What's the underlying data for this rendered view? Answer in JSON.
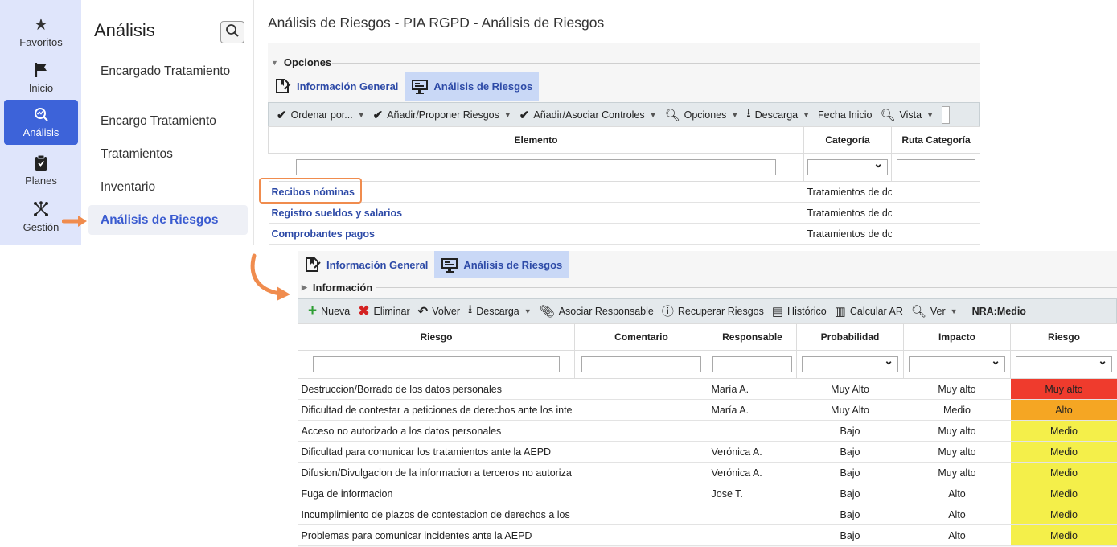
{
  "rail": [
    {
      "icon": "★",
      "label": "Favoritos",
      "active": false
    },
    {
      "icon": "⚑",
      "label": "Inicio",
      "active": false
    },
    {
      "icon": "⌕",
      "label": "Análisis",
      "active": true
    },
    {
      "icon": "▣",
      "label": "Planes",
      "active": false
    },
    {
      "icon": "✕",
      "label": "Gestión",
      "active": false
    }
  ],
  "menu": {
    "title": "Análisis",
    "items": [
      {
        "label": "Encargado Tratamiento"
      },
      {
        "label": "Encargo Tratamiento"
      },
      {
        "label": "Tratamientos"
      },
      {
        "label": "Inventario"
      },
      {
        "label": "Análisis de Riesgos"
      }
    ]
  },
  "page_title": "Análisis de Riesgos - PIA RGPD - Análisis de Riesgos",
  "top": {
    "section": "Opciones",
    "tabs": [
      "Información General",
      "Análisis de Riesgos"
    ],
    "toolbar": {
      "sort": "Ordenar por...",
      "add_risks": "Añadir/Proponer Riesgos",
      "add_controls": "Añadir/Asociar Controles",
      "options": "Opciones",
      "download": "Descarga",
      "start_date": "Fecha Inicio",
      "view": "Vista"
    },
    "columns": [
      "Elemento",
      "Categoría",
      "Ruta Categoría"
    ],
    "rows": [
      {
        "elemento": "Recibos nóminas",
        "categoria": "Tratamientos de dc",
        "ruta": ""
      },
      {
        "elemento": "Registro sueldos y salarios",
        "categoria": "Tratamientos de dc",
        "ruta": ""
      },
      {
        "elemento": "Comprobantes pagos",
        "categoria": "Tratamientos de dc",
        "ruta": ""
      }
    ]
  },
  "bottom": {
    "tabs": [
      "Información General",
      "Análisis de Riesgos"
    ],
    "section": "Información",
    "toolbar": {
      "new": "Nueva",
      "delete": "Eliminar",
      "back": "Volver",
      "download": "Descarga",
      "assign": "Asociar Responsable",
      "recover": "Recuperar Riesgos",
      "history": "Histórico",
      "calc": "Calcular AR",
      "view": "Ver",
      "nra": "NRA:Medio"
    },
    "columns": [
      "Riesgo",
      "Comentario",
      "Responsable",
      "Probabilidad",
      "Impacto",
      "Riesgo"
    ],
    "rows": [
      {
        "riesgo": "Destruccion/Borrado de los datos personales",
        "comentario": "",
        "responsable": "María A.",
        "probabilidad": "Muy Alto",
        "impacto": "Muy alto",
        "nivel": "Muy alto",
        "color": "#ef3b2d"
      },
      {
        "riesgo": "Dificultad de contestar a peticiones de derechos ante los inte",
        "comentario": "",
        "responsable": "María A.",
        "probabilidad": "Muy Alto",
        "impacto": "Medio",
        "nivel": "Alto",
        "color": "#f5a623"
      },
      {
        "riesgo": "Acceso no autorizado a los datos personales",
        "comentario": "",
        "responsable": "",
        "probabilidad": "Bajo",
        "impacto": "Muy alto",
        "nivel": "Medio",
        "color": "#f4ef4a"
      },
      {
        "riesgo": "Dificultad para comunicar los tratamientos ante la AEPD",
        "comentario": "",
        "responsable": "Verónica A.",
        "probabilidad": "Bajo",
        "impacto": "Muy alto",
        "nivel": "Medio",
        "color": "#f4ef4a"
      },
      {
        "riesgo": "Difusion/Divulgacion de la informacion a terceros no autoriza",
        "comentario": "",
        "responsable": "Verónica A.",
        "probabilidad": "Bajo",
        "impacto": "Muy alto",
        "nivel": "Medio",
        "color": "#f4ef4a"
      },
      {
        "riesgo": "Fuga de informacion",
        "comentario": "",
        "responsable": "Jose T.",
        "probabilidad": "Bajo",
        "impacto": "Alto",
        "nivel": "Medio",
        "color": "#f4ef4a"
      },
      {
        "riesgo": "Incumplimiento de plazos de contestacion de derechos a los",
        "comentario": "",
        "responsable": "",
        "probabilidad": "Bajo",
        "impacto": "Alto",
        "nivel": "Medio",
        "color": "#f4ef4a"
      },
      {
        "riesgo": "Problemas para comunicar incidentes ante la AEPD",
        "comentario": "",
        "responsable": "",
        "probabilidad": "Bajo",
        "impacto": "Alto",
        "nivel": "Medio",
        "color": "#f4ef4a"
      }
    ]
  },
  "colors": {
    "accent": "#3d63d9",
    "highlight": "#f08c4e",
    "rail_bg": "#dfe5fb",
    "tab_active": "#c9d8f6"
  }
}
